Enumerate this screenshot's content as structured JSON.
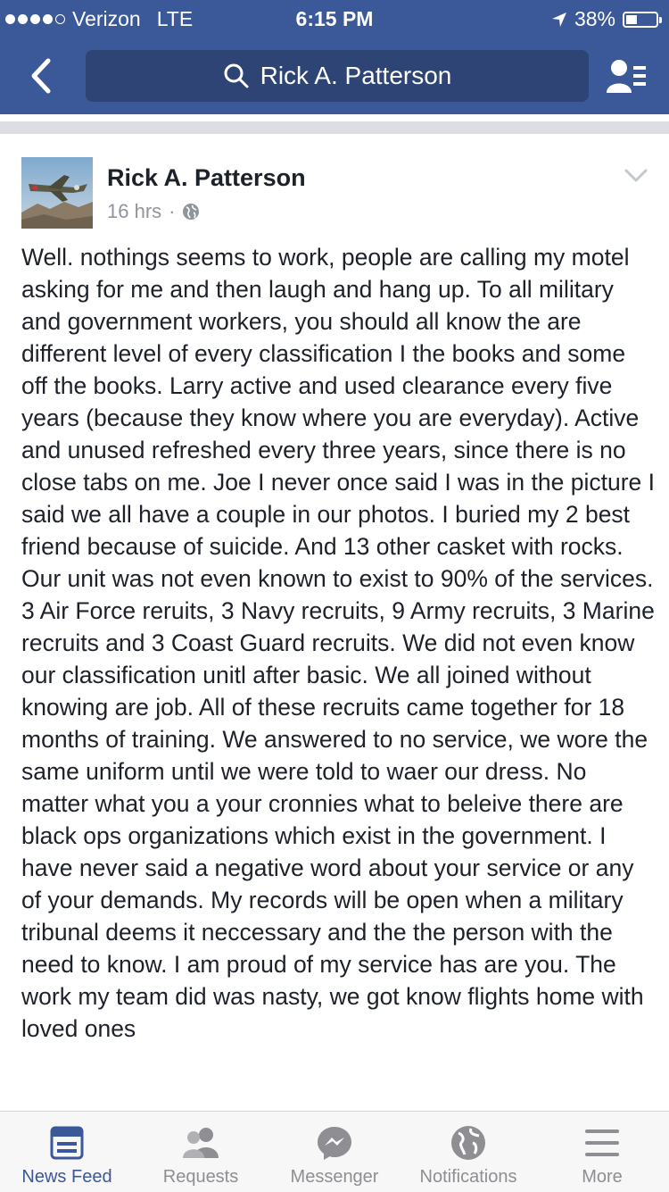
{
  "status_bar": {
    "carrier": "Verizon",
    "network": "LTE",
    "time": "6:15 PM",
    "battery": "38%",
    "battery_level": 0.38
  },
  "nav": {
    "search_text": "Rick A. Patterson"
  },
  "post": {
    "author": "Rick A. Patterson",
    "time": "16 hrs",
    "separator": "·",
    "body": "Well. nothings seems to work, people are calling my motel asking for me and then laugh and hang up.  To all military and government workers, you should all know the are different level of every classification I the books and some off the books. Larry active and used clearance every five years (because they know where you are everyday).  Active and unused refreshed every three years, since there is no close tabs on me. Joe I never once said I was in the picture I said we all have a couple in our photos.  I buried my 2 best friend because of suicide.  And 13 other casket with rocks. Our unit was not even known to exist to 90% of the services.  3 Air Force reruits, 3 Navy recruits, 9 Army recruits, 3 Marine recruits and 3 Coast Guard recruits. We did not even know our classification unitl after basic.  We all joined without knowing are job.  All of these recruits came together for 18 months of training.  We answered to no service, we wore the same uniform until we were told to waer our dress.  No matter what you a your cronnies what to beleive there are black ops organizations which exist in the government.  I have never said a negative word about your service or any of your demands.  My records will be open when a military  tribunal deems it neccessary and the the person with the need to know.  I am proud of my service has are you.  The work my team did was nasty, we got know flights home with loved ones"
  },
  "tabs": [
    {
      "label": "News Feed",
      "icon": "news-feed-icon",
      "active": true
    },
    {
      "label": "Requests",
      "icon": "requests-icon",
      "active": false
    },
    {
      "label": "Messenger",
      "icon": "messenger-icon",
      "active": false
    },
    {
      "label": "Notifications",
      "icon": "notifications-icon",
      "active": false
    },
    {
      "label": "More",
      "icon": "more-icon",
      "active": false
    }
  ],
  "colors": {
    "brand": "#3b5998",
    "inactive_tab": "#8e8e93"
  }
}
